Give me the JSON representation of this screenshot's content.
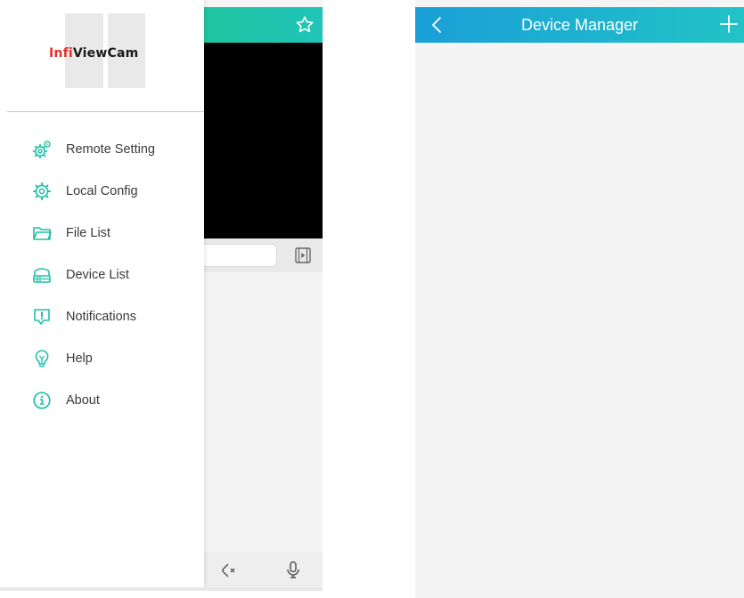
{
  "app": {
    "logo": {
      "part1": "Infi",
      "part2": "ViewCam"
    }
  },
  "drawer": {
    "items": [
      {
        "label": "Remote Setting",
        "icon": "remote-setting-icon"
      },
      {
        "label": "Local Config",
        "icon": "gear-icon"
      },
      {
        "label": "File List",
        "icon": "folder-icon"
      },
      {
        "label": "Device List",
        "icon": "device-icon"
      },
      {
        "label": "Notifications",
        "icon": "notification-icon"
      },
      {
        "label": "Help",
        "icon": "bulb-icon"
      },
      {
        "label": "About",
        "icon": "info-icon"
      }
    ]
  },
  "device_manager": {
    "title": "Device Manager"
  },
  "colors": {
    "teal_accent": "#1fc0a8",
    "header_blue": "#1a9fd8",
    "logo_red": "#e0322c",
    "divider_pink": "#f3b3b9"
  }
}
